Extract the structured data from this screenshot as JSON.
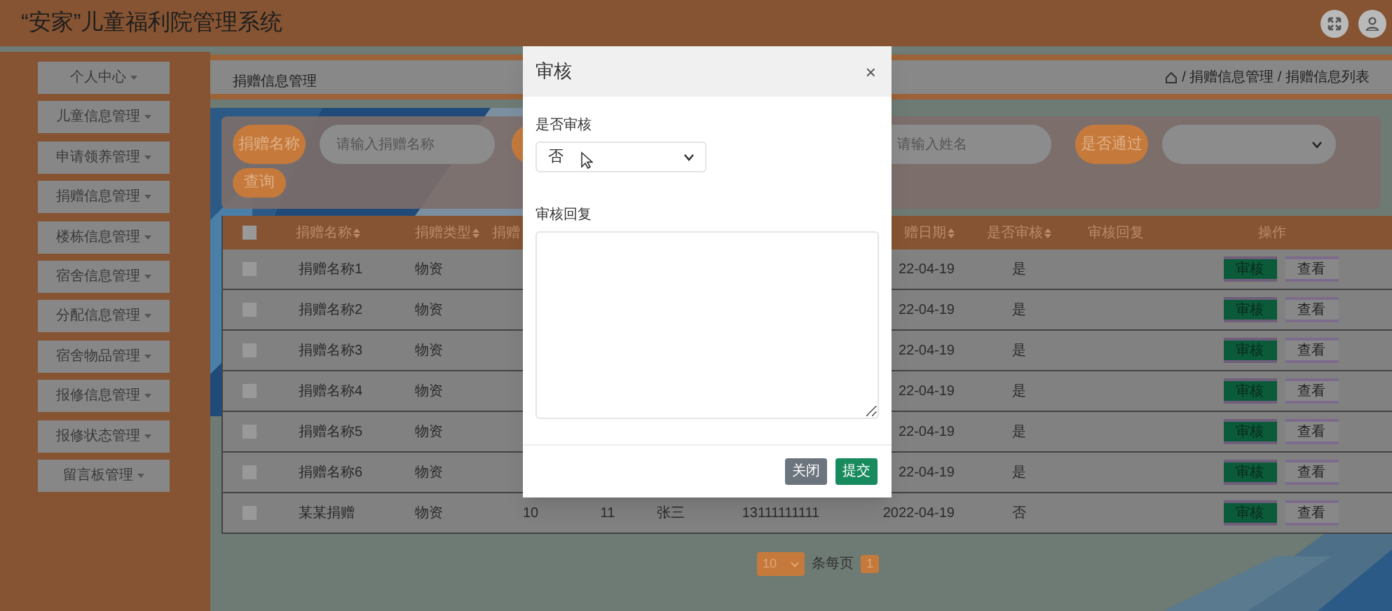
{
  "app": {
    "title": "“安家”儿童福利院管理系统"
  },
  "sidebar": {
    "items": [
      {
        "label": "个人中心"
      },
      {
        "label": "儿童信息管理"
      },
      {
        "label": "申请领养管理"
      },
      {
        "label": "捐赠信息管理"
      },
      {
        "label": "楼栋信息管理"
      },
      {
        "label": "宿舍信息管理"
      },
      {
        "label": "分配信息管理"
      },
      {
        "label": "宿舍物品管理"
      },
      {
        "label": "报修信息管理"
      },
      {
        "label": "报修状态管理"
      },
      {
        "label": "留言板管理"
      }
    ]
  },
  "breadcrumb": {
    "title": "捐赠信息管理",
    "path": "/ 捐赠信息管理 / 捐赠信息列表"
  },
  "search": {
    "fields": [
      {
        "label": "捐赠名称",
        "placeholder": "请输入捐赠名称"
      },
      {
        "placeholder": "请输入姓名"
      }
    ],
    "select": {
      "label": "是否通过"
    },
    "query_button": "查询"
  },
  "table": {
    "select_all": {
      "checked": false
    },
    "columns": [
      {
        "kind": "name",
        "label": "捐赠名称",
        "sortable": true
      },
      {
        "kind": "type",
        "label": "捐赠类型",
        "sortable": true
      },
      {
        "kind": "column_3",
        "label": "捐赠",
        "sortable": false
      },
      {
        "kind": "date",
        "label": "赠日期",
        "sortable": true
      },
      {
        "kind": "reviewed",
        "label": "是否审核",
        "sortable": true
      },
      {
        "kind": "reply",
        "label": "审核回复",
        "sortable": false
      },
      {
        "kind": "actions",
        "label": "操作",
        "sortable": false
      }
    ],
    "rows": [
      {
        "checked": false,
        "name": "捐赠名称1",
        "type": "物资",
        "date": "22-04-19",
        "reviewed": "是",
        "actions": [
          {
            "label": "审核",
            "kind": "primary"
          },
          {
            "label": "查看",
            "kind": "secondary"
          }
        ]
      },
      {
        "checked": false,
        "name": "捐赠名称2",
        "type": "物资",
        "date": "22-04-19",
        "reviewed": "是",
        "actions": [
          {
            "label": "审核",
            "kind": "primary"
          },
          {
            "label": "查看",
            "kind": "secondary"
          }
        ]
      },
      {
        "checked": false,
        "name": "捐赠名称3",
        "type": "物资",
        "date": "22-04-19",
        "reviewed": "是",
        "actions": [
          {
            "label": "审核",
            "kind": "primary"
          },
          {
            "label": "查看",
            "kind": "secondary"
          }
        ]
      },
      {
        "checked": false,
        "name": "捐赠名称4",
        "type": "物资",
        "date": "22-04-19",
        "reviewed": "是",
        "actions": [
          {
            "label": "审核",
            "kind": "primary"
          },
          {
            "label": "查看",
            "kind": "secondary"
          }
        ]
      },
      {
        "checked": false,
        "name": "捐赠名称5",
        "type": "物资",
        "date": "22-04-19",
        "reviewed": "是",
        "actions": [
          {
            "label": "审核",
            "kind": "primary"
          },
          {
            "label": "查看",
            "kind": "secondary"
          }
        ]
      },
      {
        "checked": false,
        "name": "捐赠名称6",
        "type": "物资",
        "date": "22-04-19",
        "reviewed": "是",
        "actions": [
          {
            "label": "审核",
            "kind": "primary"
          },
          {
            "label": "查看",
            "kind": "secondary"
          }
        ]
      },
      {
        "checked": false,
        "name": "某某捐赠",
        "type": "物资",
        "column_3": "10",
        "column_4": "11",
        "column_5": "张三",
        "column_6": "13111111111",
        "date": "2022-04-19",
        "reviewed": "否",
        "actions": [
          {
            "label": "审核",
            "kind": "primary"
          },
          {
            "label": "查看",
            "kind": "secondary"
          }
        ]
      }
    ]
  },
  "pagination": {
    "page_size": "10",
    "per_page_label": "条每页",
    "pages": [
      {
        "label": "1",
        "selected": true
      }
    ]
  },
  "modal": {
    "title": "审核",
    "close": "×",
    "fields": [
      {
        "kind": "select",
        "label": "是否审核",
        "value": "否"
      },
      {
        "kind": "textarea",
        "label": "审核回复"
      }
    ],
    "buttons": [
      {
        "label": "关闭",
        "kind": "secondary"
      },
      {
        "label": "提交",
        "kind": "primary"
      }
    ]
  }
}
